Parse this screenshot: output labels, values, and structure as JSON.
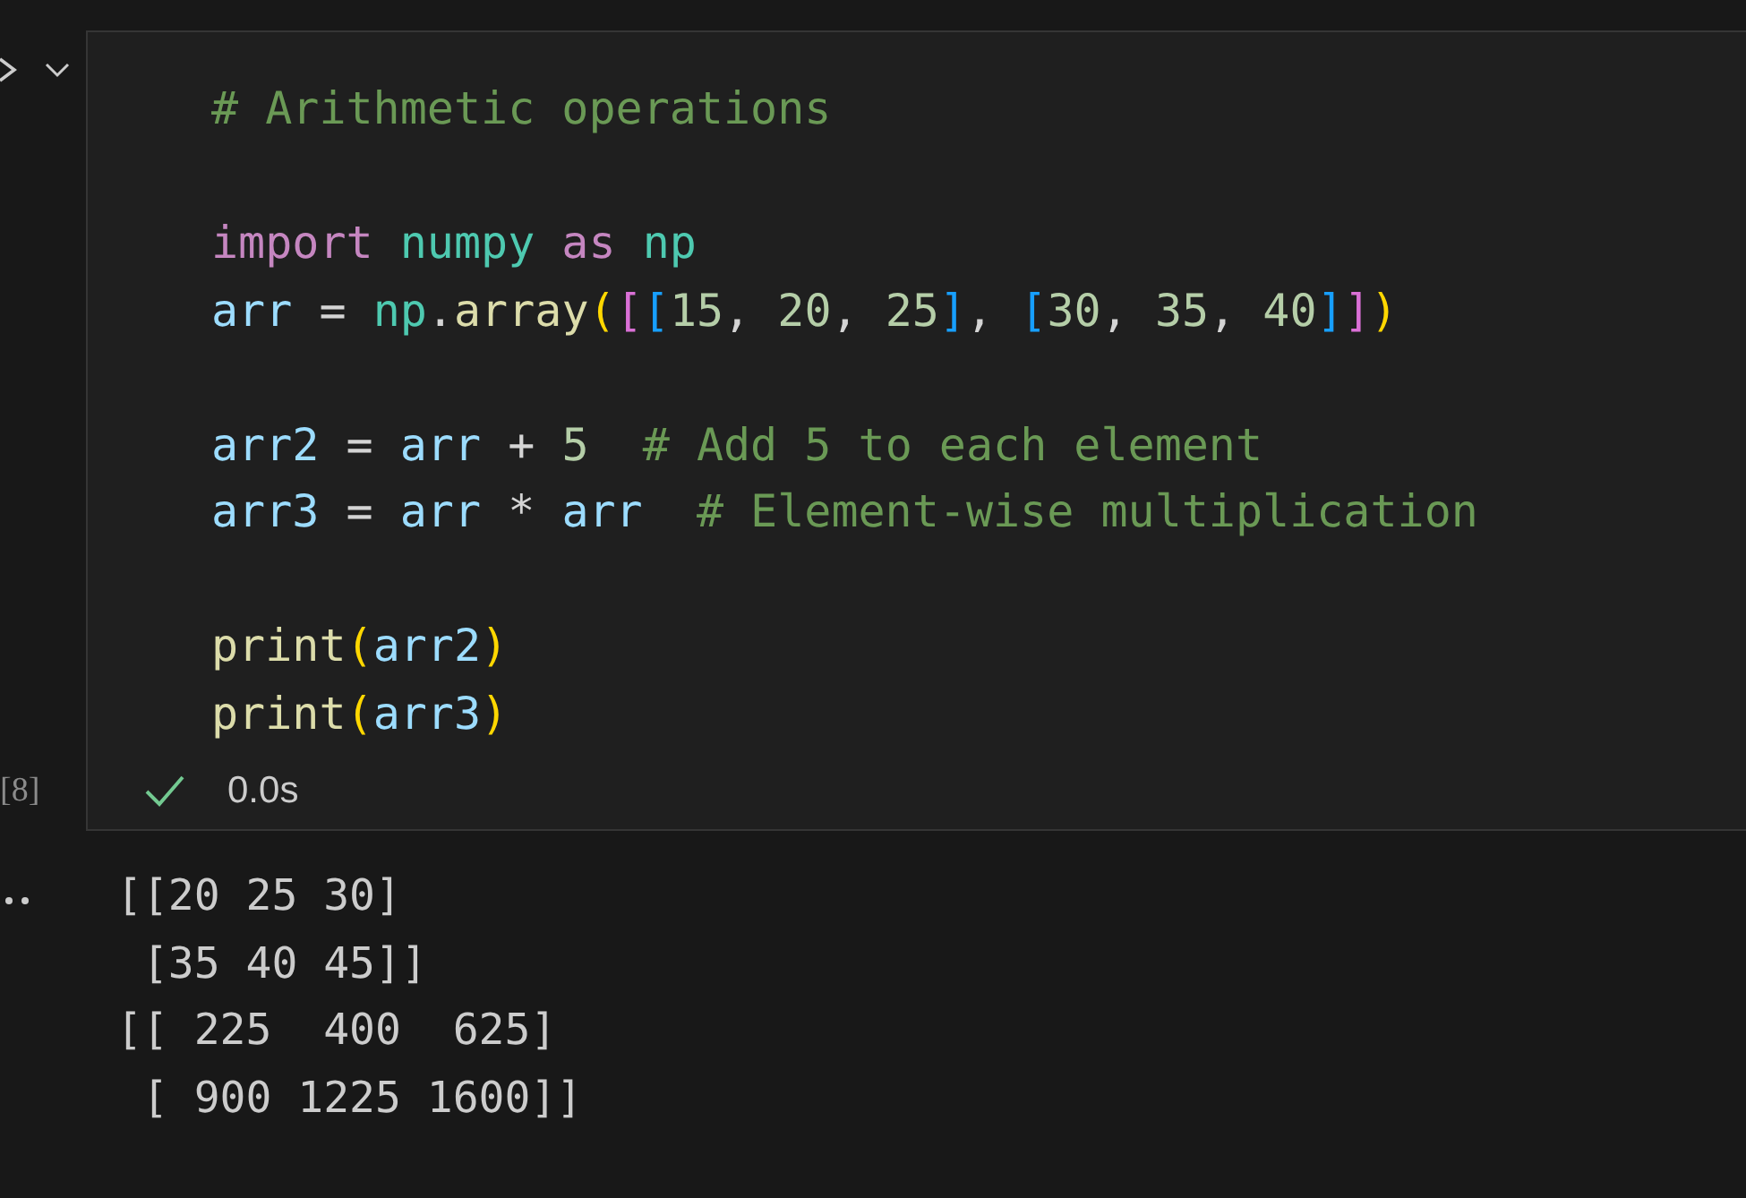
{
  "cell": {
    "execution_count": "[8]",
    "status": {
      "success": true,
      "duration": "0.0s"
    },
    "code_groups": [
      [
        [
          {
            "kind": "comment",
            "text": "# Arithmetic operations"
          }
        ]
      ],
      [
        [
          {
            "kind": "keyword",
            "text": "import "
          },
          {
            "kind": "module",
            "text": "numpy "
          },
          {
            "kind": "keyword",
            "text": "as "
          },
          {
            "kind": "module",
            "text": "np"
          }
        ],
        [
          {
            "kind": "variable",
            "text": "arr"
          },
          {
            "kind": "plain",
            "text": " = "
          },
          {
            "kind": "module",
            "text": "np"
          },
          {
            "kind": "plain",
            "text": "."
          },
          {
            "kind": "function",
            "text": "array"
          },
          {
            "kind": "bracket1",
            "text": "("
          },
          {
            "kind": "bracket2",
            "text": "["
          },
          {
            "kind": "bracket3",
            "text": "["
          },
          {
            "kind": "number",
            "text": "15"
          },
          {
            "kind": "plain",
            "text": ", "
          },
          {
            "kind": "number",
            "text": "20"
          },
          {
            "kind": "plain",
            "text": ", "
          },
          {
            "kind": "number",
            "text": "25"
          },
          {
            "kind": "bracket3",
            "text": "]"
          },
          {
            "kind": "plain",
            "text": ", "
          },
          {
            "kind": "bracket3",
            "text": "["
          },
          {
            "kind": "number",
            "text": "30"
          },
          {
            "kind": "plain",
            "text": ", "
          },
          {
            "kind": "number",
            "text": "35"
          },
          {
            "kind": "plain",
            "text": ", "
          },
          {
            "kind": "number",
            "text": "40"
          },
          {
            "kind": "bracket3",
            "text": "]"
          },
          {
            "kind": "bracket2",
            "text": "]"
          },
          {
            "kind": "bracket1",
            "text": ")"
          }
        ]
      ],
      [
        [
          {
            "kind": "variable",
            "text": "arr2"
          },
          {
            "kind": "plain",
            "text": " = "
          },
          {
            "kind": "variable",
            "text": "arr"
          },
          {
            "kind": "plain",
            "text": " + "
          },
          {
            "kind": "number",
            "text": "5"
          },
          {
            "kind": "comment",
            "text": "  # Add 5 to each element"
          }
        ],
        [
          {
            "kind": "variable",
            "text": "arr3"
          },
          {
            "kind": "plain",
            "text": " = "
          },
          {
            "kind": "variable",
            "text": "arr"
          },
          {
            "kind": "plain",
            "text": " * "
          },
          {
            "kind": "variable",
            "text": "arr"
          },
          {
            "kind": "comment",
            "text": "  # Element-wise multiplication"
          }
        ]
      ],
      [
        [
          {
            "kind": "function",
            "text": "print"
          },
          {
            "kind": "bracket1",
            "text": "("
          },
          {
            "kind": "variable",
            "text": "arr2"
          },
          {
            "kind": "bracket1",
            "text": ")"
          }
        ],
        [
          {
            "kind": "function",
            "text": "print"
          },
          {
            "kind": "bracket1",
            "text": "("
          },
          {
            "kind": "variable",
            "text": "arr3"
          },
          {
            "kind": "bracket1",
            "text": ")"
          }
        ]
      ]
    ],
    "output_lines": [
      "[[20 25 30]",
      " [35 40 45]]",
      "[[ 225  400  625]",
      " [ 900 1225 1600]]"
    ]
  }
}
